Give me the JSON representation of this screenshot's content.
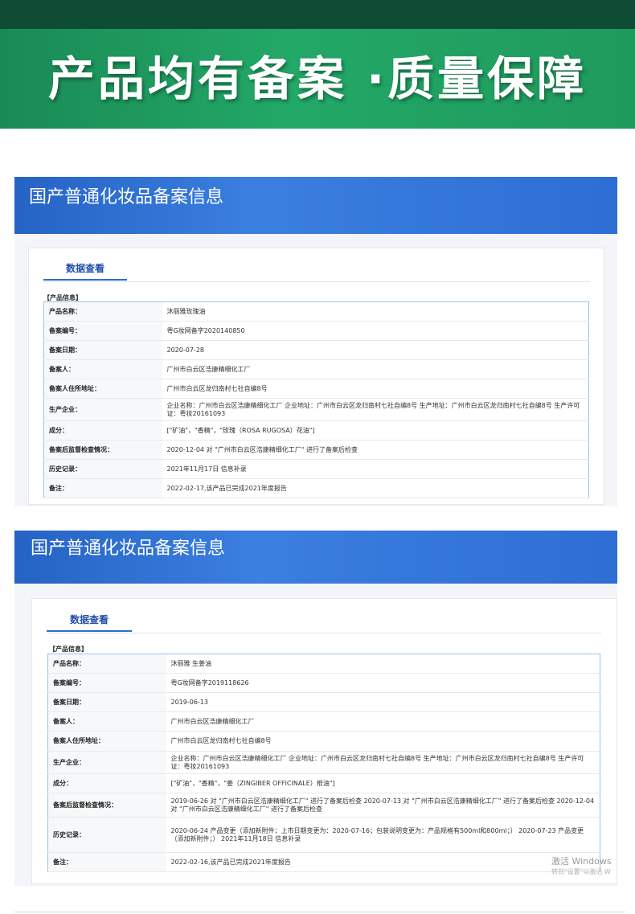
{
  "banner": {
    "title": "产品均有备案 ·质量保障"
  },
  "sections": [
    {
      "title": "国产普通化妆品备案信息",
      "tab": "数据查看",
      "caption": "【产品信息】",
      "rows": [
        {
          "label": "产品名称：",
          "value": "沐丽雅玫瑰油"
        },
        {
          "label": "备案编号：",
          "value": "粤G妆网备字2020140850"
        },
        {
          "label": "备案日期：",
          "value": "2020-07-28"
        },
        {
          "label": "备案人：",
          "value": "广州市白云区浩康精细化工厂"
        },
        {
          "label": "备案人住所地址：",
          "value": "广州市白云区龙归南村七社自编8号"
        },
        {
          "label": "生产企业：",
          "value": "企业名称：广州市白云区浩康精细化工厂 企业地址：广州市白云区龙归南村七社自编8号 生产地址：广州市白云区龙归南村七社自编8号 生产许可证：粤妆20161093"
        },
        {
          "label": "成分：",
          "value": "[\"矿油\"，\"香精\"，\"玫瑰（ROSA RUGOSA）花油\"]"
        },
        {
          "label": "备案后监督检查情况：",
          "value": "2020-12-04 对 \"广州市白云区浩康精细化工厂\" 进行了备案后检查"
        },
        {
          "label": "历史记录：",
          "value": "2021年11月17日 信息补录"
        },
        {
          "label": "备注：",
          "value": "2022-02-17,该产品已完成2021年度报告"
        }
      ]
    },
    {
      "title": "国产普通化妆品备案信息",
      "tab": "数据查看",
      "caption": "【产品信息】",
      "rows": [
        {
          "label": "产品名称：",
          "value": "沐丽雅 生姜油"
        },
        {
          "label": "备案编号：",
          "value": "粤G妆网备字2019118626"
        },
        {
          "label": "备案日期：",
          "value": "2019-06-13"
        },
        {
          "label": "备案人：",
          "value": "广州市白云区浩康精细化工厂"
        },
        {
          "label": "备案人住所地址：",
          "value": "广州市白云区龙归南村七社自编8号"
        },
        {
          "label": "生产企业：",
          "value": "企业名称：广州市白云区浩康精细化工厂 企业地址：广州市白云区龙归南村七社自编8号 生产地址：广州市白云区龙归南村七社自编8号 生产许可证：粤妆20161093"
        },
        {
          "label": "成分：",
          "value": "[\"矿油\"，\"香精\"，\"姜（ZINGIBER OFFICINALE）根油\"]"
        },
        {
          "label": "备案后监督检查情况：",
          "value": "2019-06-26 对 \"广州市白云区浩康精细化工厂\" 进行了备案后检查 2020-07-13 对 \"广州市白云区浩康精细化工厂\" 进行了备案后检查 2020-12-04 对 \"广州市白云区浩康精细化工厂\" 进行了备案后检查"
        },
        {
          "label": "历史记录：",
          "value": "2020-06-24 产品变更（添加新附件；上市日期变更为：2020-07-16；包装说明变更为：产品规格有500ml和800ml；） 2020-07-23 产品变更（添加新附件；） 2021年11月18日 信息补录"
        },
        {
          "label": "备注：",
          "value": "2022-02-16,该产品已完成2021年度报告"
        }
      ]
    }
  ],
  "watermark": {
    "line1": "激活 Windows",
    "line2": "转到\"设置\"以激活 W"
  }
}
